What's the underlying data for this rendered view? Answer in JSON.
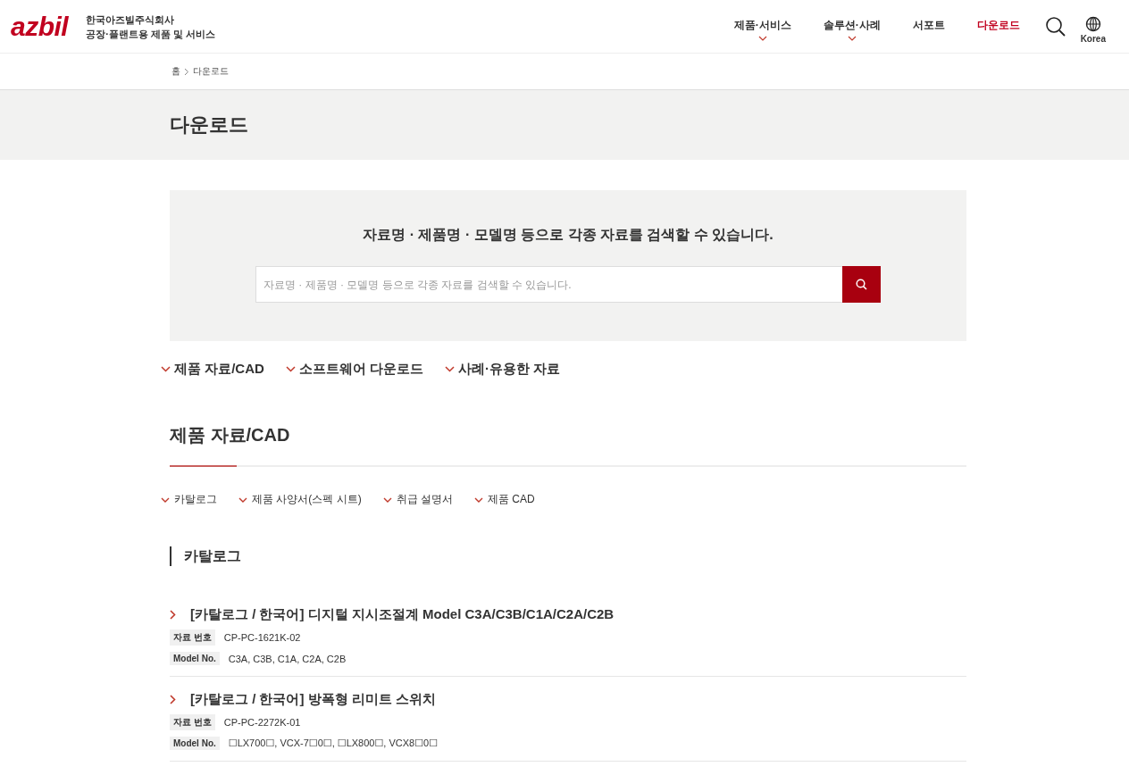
{
  "header": {
    "logo": "azbil",
    "company": "한국아즈빌주식회사",
    "tagline": "공장·플랜트용 제품 및 서비스",
    "nav": [
      {
        "label": "제품·서비스",
        "has_menu": true,
        "selected": false
      },
      {
        "label": "솔루션·사례",
        "has_menu": true,
        "selected": false
      },
      {
        "label": "서포트",
        "has_menu": false,
        "selected": false
      },
      {
        "label": "다운로드",
        "has_menu": false,
        "selected": true
      }
    ],
    "language": "Korea"
  },
  "breadcrumb": [
    "홈",
    "다운로드"
  ],
  "page_title": "다운로드",
  "search": {
    "heading": "자료명 · 제품명 · 모델명 등으로 각종 자료를 검색할 수 있습니다.",
    "placeholder": "자료명 · 제품명 · 모델명 등으로 각종 자료를 검색할 수 있습니다."
  },
  "anchor_links": [
    "제품 자료/CAD",
    "소프트웨어 다운로드",
    "사례·유용한 자료"
  ],
  "section": {
    "title": "제품 자료/CAD",
    "sub_links": [
      "카탈로그",
      "제품 사양서(스펙 시트)",
      "취급 설명서",
      "제품 CAD"
    ],
    "subsection_title": "카탈로그",
    "documents": [
      {
        "title": "[카탈로그 / 한국어] 디지털 지시조절계 Model C3A/C3B/C1A/C2A/C2B",
        "fields": [
          {
            "label": "자료 번호",
            "value": "CP-PC-1621K-02"
          },
          {
            "label": "Model No.",
            "value": "C3A, C3B, C1A, C2A, C2B"
          }
        ]
      },
      {
        "title": "[카탈로그 / 한국어] 방폭형 리미트 스위치",
        "fields": [
          {
            "label": "자료 번호",
            "value": "CP-PC-2272K-01"
          },
          {
            "label": "Model No.",
            "value": "☐LX700☐, VCX-7☐0☐, ☐LX800☐, VCX8☐0☐"
          }
        ]
      }
    ]
  }
}
